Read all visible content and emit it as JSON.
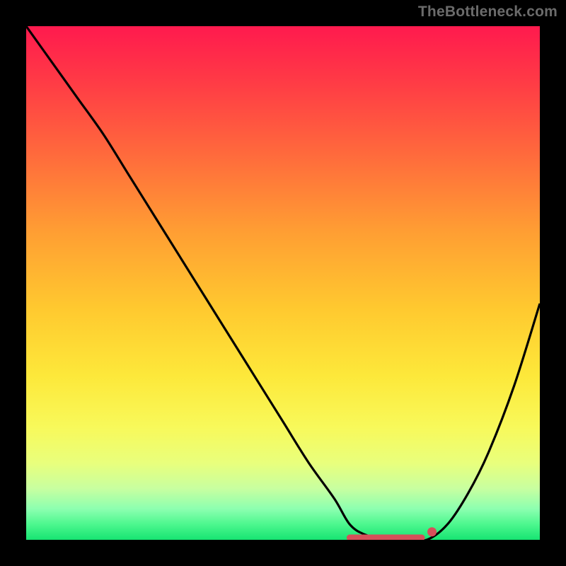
{
  "watermark": "TheBottleneck.com",
  "colors": {
    "background_frame": "#000000",
    "curve": "#000000",
    "marker": "#d6505a"
  },
  "chart_data": {
    "type": "line",
    "title": "",
    "xlabel": "",
    "ylabel": "",
    "xlim": [
      0,
      100
    ],
    "ylim": [
      0,
      100
    ],
    "x": [
      0,
      5,
      10,
      15,
      20,
      25,
      30,
      35,
      40,
      45,
      50,
      55,
      60,
      63,
      66,
      70,
      74,
      78,
      82,
      86,
      90,
      95,
      100
    ],
    "y": [
      100,
      93,
      86,
      79,
      71,
      63,
      55,
      47,
      39,
      31,
      23,
      15,
      8,
      3,
      1,
      0,
      0,
      0,
      3,
      9,
      17,
      30,
      46
    ],
    "markers": {
      "flat_segment": {
        "x_start": 63,
        "x_end": 77,
        "y": 0
      },
      "point": {
        "x": 79,
        "y": 1
      }
    },
    "gradient_stops": [
      {
        "pos": 0,
        "color": "#ff1a4e"
      },
      {
        "pos": 0.25,
        "color": "#ff6a3c"
      },
      {
        "pos": 0.55,
        "color": "#ffc92f"
      },
      {
        "pos": 0.78,
        "color": "#f8f95a"
      },
      {
        "pos": 0.94,
        "color": "#8cffb0"
      },
      {
        "pos": 1.0,
        "color": "#17e472"
      }
    ]
  }
}
